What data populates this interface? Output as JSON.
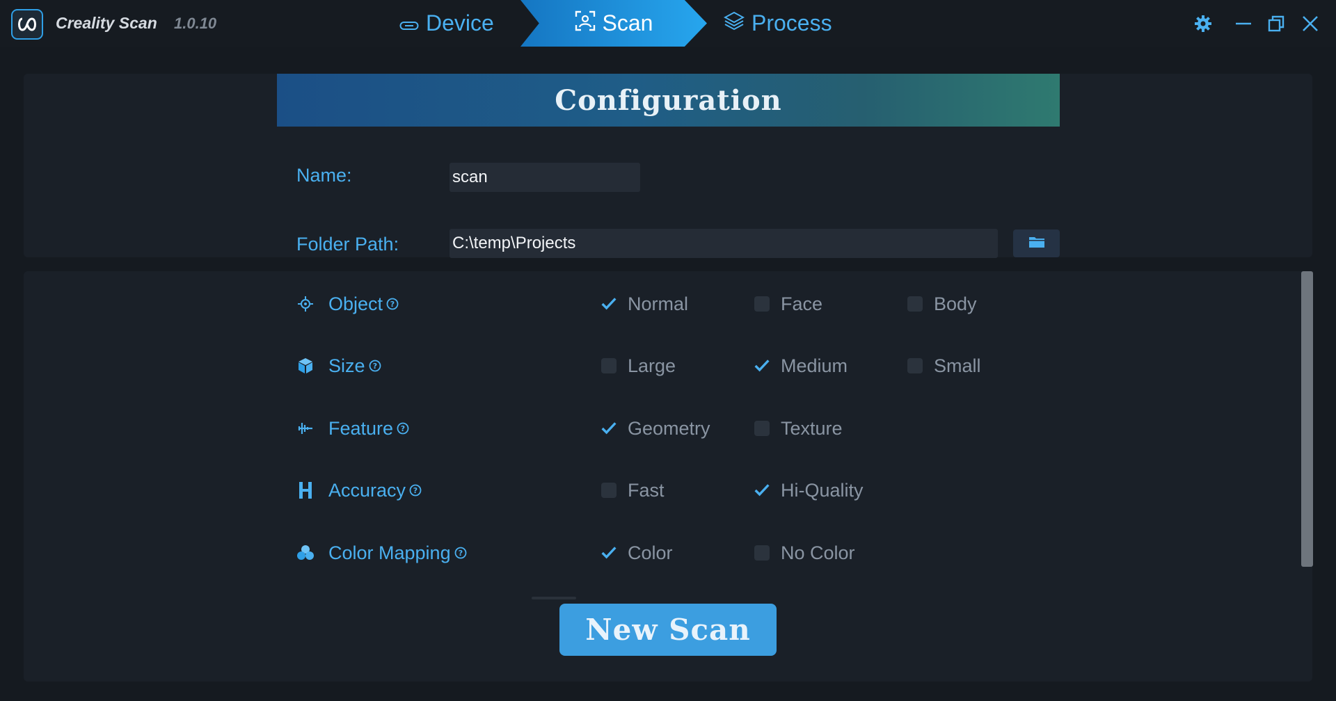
{
  "app": {
    "name": "Creality Scan",
    "version": "1.0.10",
    "accent_color": "#2f9fe6"
  },
  "tabs": [
    {
      "label": "Device",
      "icon": "device-icon",
      "active": false
    },
    {
      "label": "Scan",
      "icon": "scan-icon",
      "active": true
    },
    {
      "label": "Process",
      "icon": "layers-icon",
      "active": false
    }
  ],
  "window_controls": [
    "gear-icon",
    "minimize-icon",
    "restore-icon",
    "close-icon"
  ],
  "configuration": {
    "title": "Configuration",
    "name_label": "Name:",
    "name_value": "scan",
    "folder_label": "Folder Path:",
    "folder_value": "C:\\temp\\Projects"
  },
  "options": [
    {
      "label": "Object",
      "icon": "target-icon",
      "choices": [
        {
          "label": "Normal",
          "checked": true
        },
        {
          "label": "Face",
          "checked": false
        },
        {
          "label": "Body",
          "checked": false
        }
      ]
    },
    {
      "label": "Size",
      "icon": "cube-icon",
      "choices": [
        {
          "label": "Large",
          "checked": false
        },
        {
          "label": "Medium",
          "checked": true
        },
        {
          "label": "Small",
          "checked": false
        }
      ]
    },
    {
      "label": "Feature",
      "icon": "waveform-icon",
      "choices": [
        {
          "label": "Geometry",
          "checked": true
        },
        {
          "label": "Texture",
          "checked": false
        }
      ]
    },
    {
      "label": "Accuracy",
      "icon": "h-icon",
      "choices": [
        {
          "label": "Fast",
          "checked": false
        },
        {
          "label": "Hi-Quality",
          "checked": true
        }
      ]
    },
    {
      "label": "Color Mapping",
      "icon": "palette-icon",
      "choices": [
        {
          "label": "Color",
          "checked": true
        },
        {
          "label": "No Color",
          "checked": false
        }
      ]
    }
  ],
  "actions": {
    "new_scan_label": "New Scan"
  }
}
